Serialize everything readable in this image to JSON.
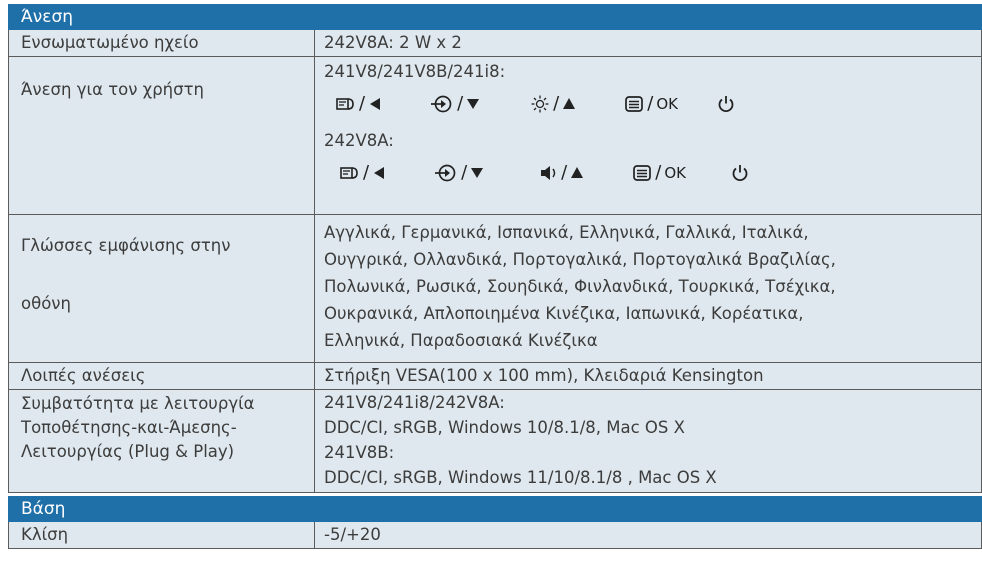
{
  "sections": {
    "comfort": "Άνεση",
    "stand": "Βάση"
  },
  "rows": {
    "speaker": {
      "label": "Ενσωματωμένο ηχείο",
      "value": "242V8A: 2 W x 2"
    },
    "ease": {
      "label": "Άνεση για τον χρήστη",
      "model_a": "241V8/241V8B/241i8:",
      "model_b": "242V8A:",
      "ok_label": "OK",
      "icons_a": [
        "menu-icon",
        "arrow-left-icon",
        "input-icon",
        "arrow-down-icon",
        "brightness-icon",
        "arrow-up-icon",
        "menu-list-icon",
        "power-icon"
      ],
      "icons_b": [
        "menu-icon",
        "arrow-left-icon",
        "input-icon",
        "arrow-down-icon",
        "volume-icon",
        "arrow-up-icon",
        "menu-list-icon",
        "power-icon"
      ]
    },
    "osd": {
      "label_1": "Γλώσσες εμφάνισης στην",
      "label_2": "οθόνη",
      "lines": [
        "Αγγλικά, Γερμανικά, Ισπανικά, Ελληνικά, Γαλλικά, Ιταλικά,",
        "Ουγγρικά, Ολλανδικά, Πορτογαλικά, Πορτογαλικά Βραζιλίας,",
        "Πολωνικά, Ρωσικά, Σουηδικά, Φινλανδικά, Τουρκικά, Τσέχικα,",
        "Ουκρανικά, Απλοποιημένα Κινέζικα, Ιαπωνικά, Κορέατικα,",
        "Ελληνικά, Παραδοσιακά Κινέζικα"
      ]
    },
    "other": {
      "label": "Λοιπές ανέσεις",
      "value": "Στήριξη VESA(100 x 100 mm), Κλειδαριά Kensington"
    },
    "plug": {
      "label_lines": [
        "Συμβατότητα με λειτουργία",
        "Τοποθέτησης-και-Άμεσης-",
        "Λειτουργίας (Plug & Play)"
      ],
      "value_lines": [
        "241V8/241i8/242V8A:",
        "DDC/CI, sRGB, Windows 10/8.1/8, Mac OS X",
        "241V8B:",
        "DDC/CI, sRGB, Windows 11/10/8.1/8 , Mac OS X"
      ]
    },
    "tilt": {
      "label": "Κλίση",
      "value": "-5/+20"
    }
  },
  "colors": {
    "header": "#1f6fa9",
    "row": "#dfe8ee",
    "border": "#5b5b5b"
  }
}
